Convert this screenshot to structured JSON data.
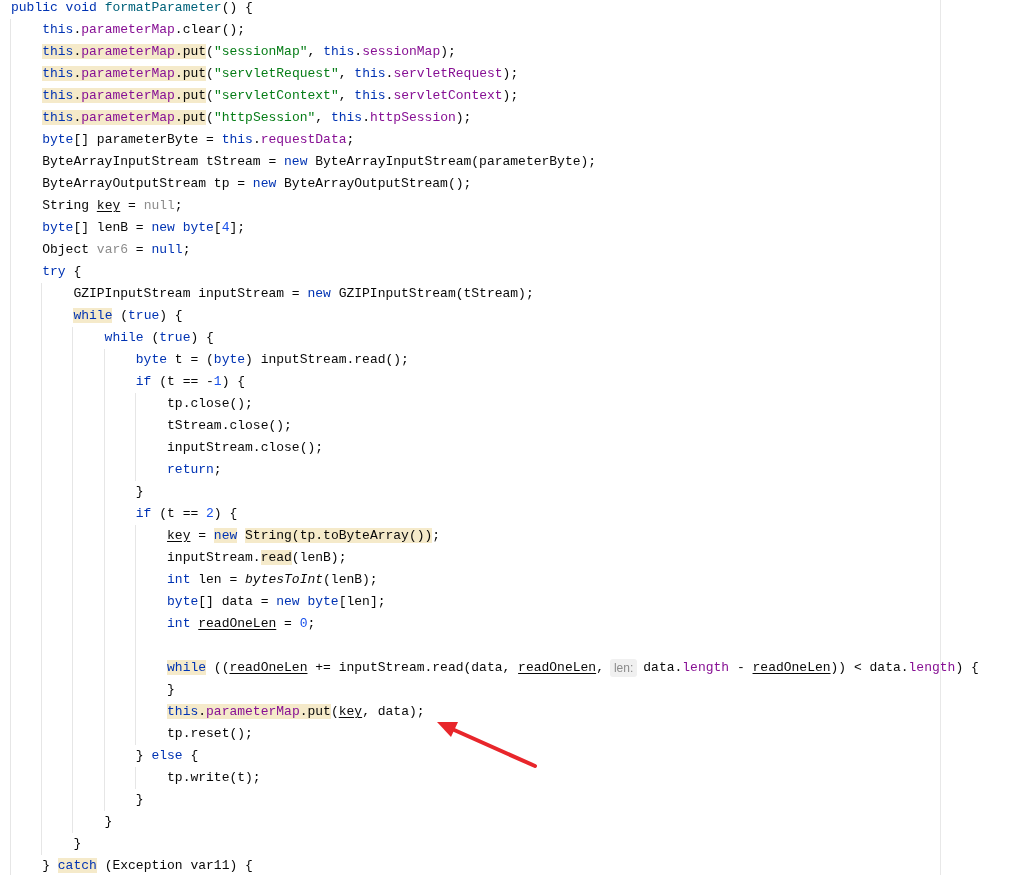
{
  "editor": {
    "lines": [
      {
        "kind": "code",
        "tokens": [
          {
            "text": "public void ",
            "kind": "keyword"
          },
          {
            "text": "formatParameter",
            "kind": "declaration"
          },
          {
            "text": "() {",
            "kind": "plain"
          }
        ]
      },
      {
        "kind": "code",
        "tokens": [
          {
            "text": "    this",
            "kind": "keyword"
          },
          {
            "text": ".",
            "kind": "plain"
          },
          {
            "text": "parameterMap",
            "kind": "field"
          },
          {
            "text": ".clear();",
            "kind": "plain"
          }
        ]
      },
      {
        "kind": "code",
        "tokens": [
          {
            "text": "    this",
            "kind": "keyword",
            "highlight": true
          },
          {
            "text": ".",
            "kind": "plain",
            "highlight": true
          },
          {
            "text": "parameterMap",
            "kind": "field",
            "highlight": true
          },
          {
            "text": ".put",
            "kind": "plain",
            "highlight": true
          },
          {
            "text": "(",
            "kind": "plain"
          },
          {
            "text": "\"sessionMap\"",
            "kind": "string"
          },
          {
            "text": ", ",
            "kind": "plain"
          },
          {
            "text": "this",
            "kind": "keyword"
          },
          {
            "text": ".",
            "kind": "plain"
          },
          {
            "text": "sessionMap",
            "kind": "field"
          },
          {
            "text": ");",
            "kind": "plain"
          }
        ]
      },
      {
        "kind": "code",
        "tokens": [
          {
            "text": "    this",
            "kind": "keyword",
            "highlight": true
          },
          {
            "text": ".",
            "kind": "plain",
            "highlight": true
          },
          {
            "text": "parameterMap",
            "kind": "field",
            "highlight": true
          },
          {
            "text": ".put",
            "kind": "plain",
            "highlight": true
          },
          {
            "text": "(",
            "kind": "plain"
          },
          {
            "text": "\"servletRequest\"",
            "kind": "string"
          },
          {
            "text": ", ",
            "kind": "plain"
          },
          {
            "text": "this",
            "kind": "keyword"
          },
          {
            "text": ".",
            "kind": "plain"
          },
          {
            "text": "servletRequest",
            "kind": "field"
          },
          {
            "text": ");",
            "kind": "plain"
          }
        ]
      },
      {
        "kind": "code",
        "tokens": [
          {
            "text": "    this",
            "kind": "keyword",
            "highlight": true
          },
          {
            "text": ".",
            "kind": "plain",
            "highlight": true
          },
          {
            "text": "parameterMap",
            "kind": "field",
            "highlight": true
          },
          {
            "text": ".put",
            "kind": "plain",
            "highlight": true
          },
          {
            "text": "(",
            "kind": "plain"
          },
          {
            "text": "\"servletContext\"",
            "kind": "string"
          },
          {
            "text": ", ",
            "kind": "plain"
          },
          {
            "text": "this",
            "kind": "keyword"
          },
          {
            "text": ".",
            "kind": "plain"
          },
          {
            "text": "servletContext",
            "kind": "field"
          },
          {
            "text": ");",
            "kind": "plain"
          }
        ]
      },
      {
        "kind": "code",
        "tokens": [
          {
            "text": "    this",
            "kind": "keyword",
            "highlight": true
          },
          {
            "text": ".",
            "kind": "plain",
            "highlight": true
          },
          {
            "text": "parameterMap",
            "kind": "field",
            "highlight": true
          },
          {
            "text": ".put",
            "kind": "plain",
            "highlight": true
          },
          {
            "text": "(",
            "kind": "plain"
          },
          {
            "text": "\"httpSession\"",
            "kind": "string"
          },
          {
            "text": ", ",
            "kind": "plain"
          },
          {
            "text": "this",
            "kind": "keyword"
          },
          {
            "text": ".",
            "kind": "plain"
          },
          {
            "text": "httpSession",
            "kind": "field"
          },
          {
            "text": ");",
            "kind": "plain"
          }
        ]
      },
      {
        "kind": "code",
        "tokens": [
          {
            "text": "    byte",
            "kind": "keyword"
          },
          {
            "text": "[] parameterByte = ",
            "kind": "plain"
          },
          {
            "text": "this",
            "kind": "keyword"
          },
          {
            "text": ".",
            "kind": "plain"
          },
          {
            "text": "requestData",
            "kind": "field"
          },
          {
            "text": ";",
            "kind": "plain"
          }
        ]
      },
      {
        "kind": "code",
        "tokens": [
          {
            "text": "    ByteArrayInputStream tStream = ",
            "kind": "plain"
          },
          {
            "text": "new",
            "kind": "keyword"
          },
          {
            "text": " ByteArrayInputStream(parameterByte);",
            "kind": "plain"
          }
        ]
      },
      {
        "kind": "code",
        "tokens": [
          {
            "text": "    ByteArrayOutputStream tp = ",
            "kind": "plain"
          },
          {
            "text": "new",
            "kind": "keyword"
          },
          {
            "text": " ByteArrayOutputStream();",
            "kind": "plain"
          }
        ]
      },
      {
        "kind": "code",
        "tokens": [
          {
            "text": "    String ",
            "kind": "plain"
          },
          {
            "text": "key",
            "kind": "plain",
            "underline": true
          },
          {
            "text": " = ",
            "kind": "plain"
          },
          {
            "text": "null",
            "kind": "unused"
          },
          {
            "text": ";",
            "kind": "plain"
          }
        ]
      },
      {
        "kind": "code",
        "tokens": [
          {
            "text": "    byte",
            "kind": "keyword"
          },
          {
            "text": "[] lenB = ",
            "kind": "plain"
          },
          {
            "text": "new byte",
            "kind": "keyword"
          },
          {
            "text": "[",
            "kind": "plain"
          },
          {
            "text": "4",
            "kind": "number"
          },
          {
            "text": "];",
            "kind": "plain"
          }
        ]
      },
      {
        "kind": "code",
        "tokens": [
          {
            "text": "    Object ",
            "kind": "plain"
          },
          {
            "text": "var6",
            "kind": "unused"
          },
          {
            "text": " = ",
            "kind": "plain"
          },
          {
            "text": "null",
            "kind": "keyword"
          },
          {
            "text": ";",
            "kind": "plain"
          }
        ]
      },
      {
        "kind": "code",
        "tokens": [
          {
            "text": "    try",
            "kind": "keyword"
          },
          {
            "text": " {",
            "kind": "plain"
          }
        ]
      },
      {
        "kind": "code",
        "tokens": [
          {
            "text": "        GZIPInputStream inputStream = ",
            "kind": "plain"
          },
          {
            "text": "new",
            "kind": "keyword"
          },
          {
            "text": " GZIPInputStream(tStream);",
            "kind": "plain"
          }
        ]
      },
      {
        "kind": "code",
        "tokens": [
          {
            "text": "        while",
            "kind": "keyword",
            "highlight": true
          },
          {
            "text": " (",
            "kind": "plain"
          },
          {
            "text": "true",
            "kind": "keyword"
          },
          {
            "text": ") {",
            "kind": "plain"
          }
        ]
      },
      {
        "kind": "code",
        "tokens": [
          {
            "text": "            while",
            "kind": "keyword"
          },
          {
            "text": " (",
            "kind": "plain"
          },
          {
            "text": "true",
            "kind": "keyword"
          },
          {
            "text": ") {",
            "kind": "plain"
          }
        ]
      },
      {
        "kind": "code",
        "tokens": [
          {
            "text": "                byte",
            "kind": "keyword"
          },
          {
            "text": " t = (",
            "kind": "plain"
          },
          {
            "text": "byte",
            "kind": "keyword"
          },
          {
            "text": ") inputStream.read();",
            "kind": "plain"
          }
        ]
      },
      {
        "kind": "code",
        "tokens": [
          {
            "text": "                if",
            "kind": "keyword"
          },
          {
            "text": " (t == -",
            "kind": "plain"
          },
          {
            "text": "1",
            "kind": "number"
          },
          {
            "text": ") {",
            "kind": "plain"
          }
        ]
      },
      {
        "kind": "code",
        "tokens": [
          {
            "text": "                    tp.close();",
            "kind": "plain"
          }
        ]
      },
      {
        "kind": "code",
        "tokens": [
          {
            "text": "                    tStream.close();",
            "kind": "plain"
          }
        ]
      },
      {
        "kind": "code",
        "tokens": [
          {
            "text": "                    inputStream.close();",
            "kind": "plain"
          }
        ]
      },
      {
        "kind": "code",
        "tokens": [
          {
            "text": "                    return",
            "kind": "keyword"
          },
          {
            "text": ";",
            "kind": "plain"
          }
        ]
      },
      {
        "kind": "code",
        "tokens": [
          {
            "text": "                }",
            "kind": "plain"
          }
        ]
      },
      {
        "kind": "code",
        "tokens": [
          {
            "text": "                if",
            "kind": "keyword"
          },
          {
            "text": " (t == ",
            "kind": "plain"
          },
          {
            "text": "2",
            "kind": "number"
          },
          {
            "text": ") {",
            "kind": "plain"
          }
        ]
      },
      {
        "kind": "code",
        "tokens": [
          {
            "text": "                    key",
            "kind": "plain",
            "underline": true
          },
          {
            "text": " = ",
            "kind": "plain"
          },
          {
            "text": "new",
            "kind": "keyword",
            "highlight": true
          },
          {
            "text": " String(tp.toByteArray())",
            "kind": "plain",
            "highlight": true
          },
          {
            "text": ";",
            "kind": "plain"
          }
        ]
      },
      {
        "kind": "code",
        "tokens": [
          {
            "text": "                    inputStream.",
            "kind": "plain"
          },
          {
            "text": "read",
            "kind": "plain",
            "highlight": true
          },
          {
            "text": "(lenB);",
            "kind": "plain"
          }
        ]
      },
      {
        "kind": "code",
        "tokens": [
          {
            "text": "                    int",
            "kind": "keyword"
          },
          {
            "text": " len = ",
            "kind": "plain"
          },
          {
            "text": "bytesToInt",
            "kind": "static"
          },
          {
            "text": "(lenB);",
            "kind": "plain"
          }
        ]
      },
      {
        "kind": "code",
        "tokens": [
          {
            "text": "                    byte",
            "kind": "keyword"
          },
          {
            "text": "[] data = ",
            "kind": "plain"
          },
          {
            "text": "new byte",
            "kind": "keyword"
          },
          {
            "text": "[len];",
            "kind": "plain"
          }
        ]
      },
      {
        "kind": "code",
        "tokens": [
          {
            "text": "                    int",
            "kind": "keyword"
          },
          {
            "text": " readOneLen",
            "kind": "plain",
            "underline": true
          },
          {
            "text": " = ",
            "kind": "plain"
          },
          {
            "text": "0",
            "kind": "number"
          },
          {
            "text": ";",
            "kind": "plain"
          }
        ]
      },
      {
        "kind": "blank"
      },
      {
        "kind": "code",
        "tokens": [
          {
            "text": "                    while",
            "kind": "keyword",
            "highlight": true
          },
          {
            "text": " ((",
            "kind": "plain"
          },
          {
            "text": "readOneLen",
            "kind": "plain",
            "underline": true
          },
          {
            "text": " += inputStream.read(data, ",
            "kind": "plain"
          },
          {
            "text": "readOneLen",
            "kind": "plain",
            "underline": true
          },
          {
            "text": ",",
            "kind": "plain"
          },
          {
            "text": "len:",
            "kind": "hint"
          },
          {
            "text": "data.",
            "kind": "plain"
          },
          {
            "text": "length",
            "kind": "field"
          },
          {
            "text": " - ",
            "kind": "plain"
          },
          {
            "text": "readOneLen",
            "kind": "plain",
            "underline": true
          },
          {
            "text": ")) < data.",
            "kind": "plain"
          },
          {
            "text": "length",
            "kind": "field"
          },
          {
            "text": ") {",
            "kind": "plain"
          }
        ]
      },
      {
        "kind": "code",
        "tokens": [
          {
            "text": "                    }",
            "kind": "plain"
          }
        ]
      },
      {
        "kind": "code",
        "tokens": [
          {
            "text": "                    this",
            "kind": "keyword",
            "highlight": true
          },
          {
            "text": ".",
            "kind": "plain",
            "highlight": true
          },
          {
            "text": "parameterMap",
            "kind": "field",
            "highlight": true
          },
          {
            "text": ".put",
            "kind": "plain",
            "highlight": true
          },
          {
            "text": "(",
            "kind": "plain"
          },
          {
            "text": "key",
            "kind": "plain",
            "underline": true
          },
          {
            "text": ", data);",
            "kind": "plain"
          }
        ]
      },
      {
        "kind": "code",
        "tokens": [
          {
            "text": "                    tp.reset();",
            "kind": "plain"
          }
        ]
      },
      {
        "kind": "code",
        "tokens": [
          {
            "text": "                } ",
            "kind": "plain"
          },
          {
            "text": "else",
            "kind": "keyword"
          },
          {
            "text": " {",
            "kind": "plain"
          }
        ]
      },
      {
        "kind": "code",
        "tokens": [
          {
            "text": "                    tp.write(t);",
            "kind": "plain"
          }
        ]
      },
      {
        "kind": "code",
        "tokens": [
          {
            "text": "                }",
            "kind": "plain"
          }
        ]
      },
      {
        "kind": "code",
        "tokens": [
          {
            "text": "            }",
            "kind": "plain"
          }
        ]
      },
      {
        "kind": "code",
        "tokens": [
          {
            "text": "        }",
            "kind": "plain"
          }
        ]
      },
      {
        "kind": "code",
        "tokens": [
          {
            "text": "    } ",
            "kind": "plain"
          },
          {
            "text": "catch",
            "kind": "keyword",
            "highlight": true
          },
          {
            "text": " (Exception var11) {",
            "kind": "plain"
          }
        ]
      }
    ]
  }
}
